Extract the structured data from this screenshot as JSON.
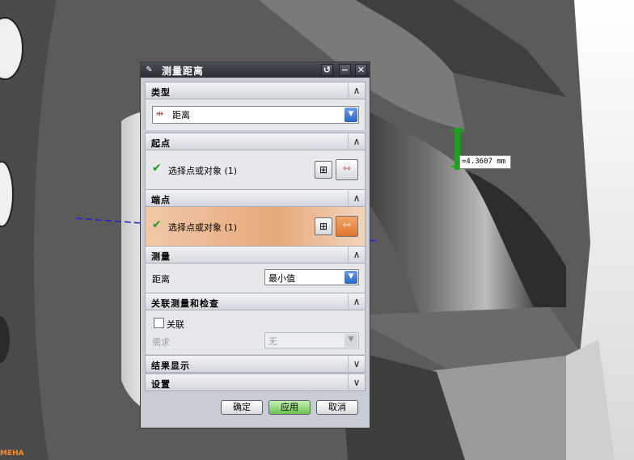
{
  "dialog": {
    "title": "测量距离",
    "title_buttons": [
      "↺",
      "−",
      "✕"
    ],
    "sections": {
      "type": {
        "label": "类型",
        "value": "距离"
      },
      "start": {
        "label": "起点",
        "select_text": "选择点或对象 (1)"
      },
      "end": {
        "label": "端点",
        "select_text": "选择点或对象 (1)"
      },
      "measure": {
        "label": "测量",
        "field_label": "距离",
        "value": "最小值"
      },
      "assoc": {
        "label": "关联测量和检查",
        "checkbox_label": "关联",
        "req_label": "需求",
        "req_value": "无"
      },
      "result": {
        "label": "结果显示"
      },
      "settings": {
        "label": "设置"
      }
    },
    "buttons": {
      "ok": "确定",
      "apply": "应用",
      "cancel": "取消"
    }
  },
  "viewport": {
    "dimension_text": "=4.3607 mm",
    "corner_text": "MEHA"
  },
  "colors": {
    "accent_blue": "#2b62c4",
    "check_green": "#1f9a1f",
    "active_row": "#e6a879",
    "apply_green": "#6cc24e",
    "measure_green": "#1fa11f"
  }
}
